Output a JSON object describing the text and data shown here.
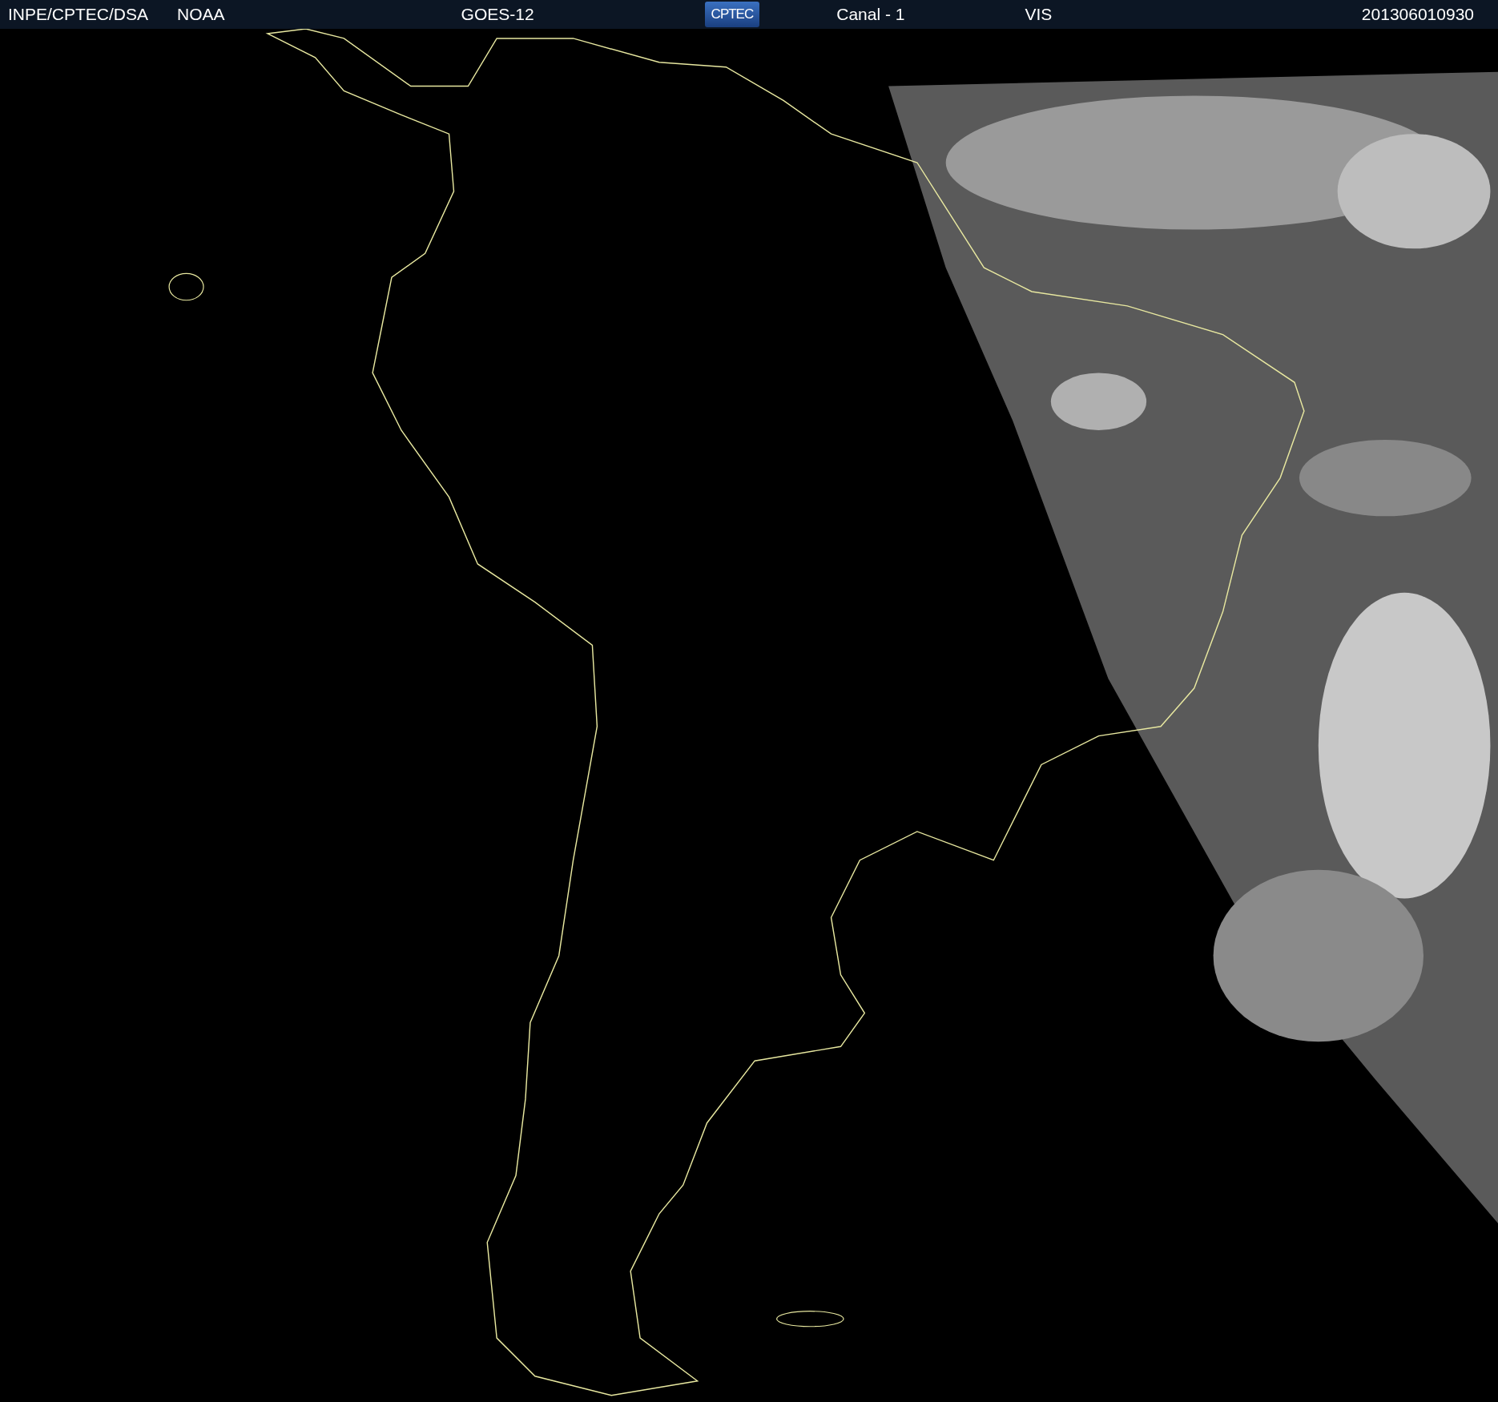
{
  "header": {
    "source": "INPE/CPTEC/DSA",
    "agency": "NOAA",
    "satellite": "GOES-12",
    "logo": "CPTEC",
    "channel": "Canal - 1",
    "band": "VIS",
    "timestamp": "201306010930"
  }
}
